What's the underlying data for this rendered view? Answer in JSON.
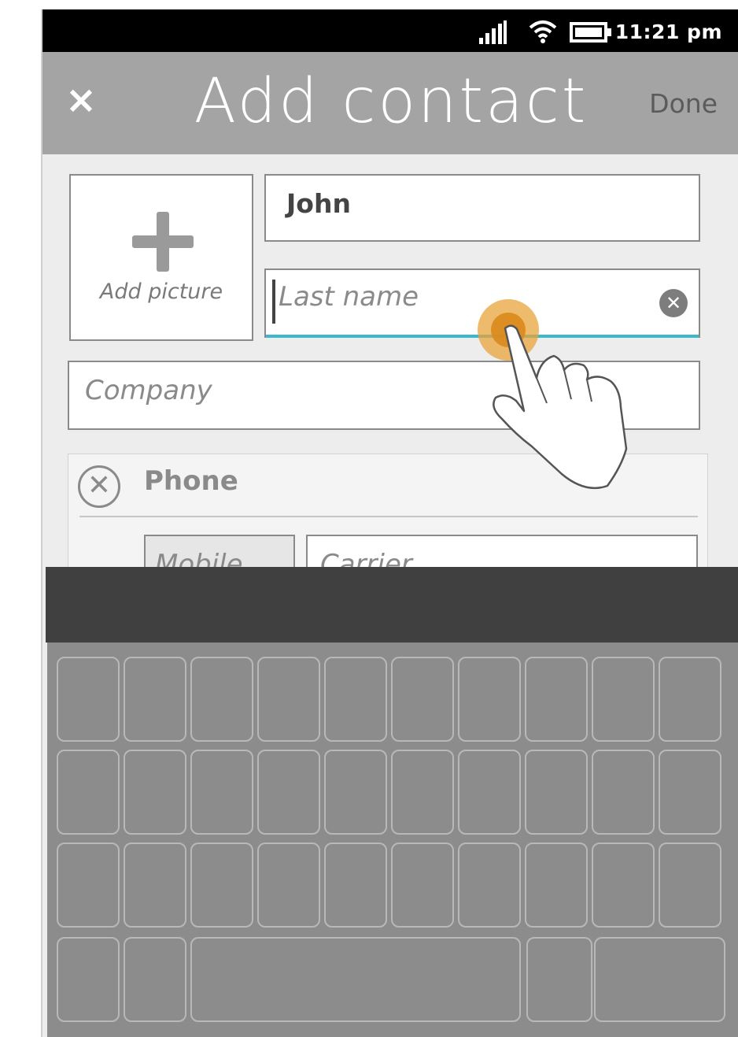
{
  "status_bar": {
    "time": "11:21 pm",
    "icons": [
      "signal-icon",
      "wifi-icon",
      "battery-icon"
    ]
  },
  "header": {
    "close_label": "×",
    "title": "Add contact",
    "done_label": "Done"
  },
  "form": {
    "add_picture_label": "Add picture",
    "first_name_value": "John",
    "last_name_placeholder": "Last name",
    "company_placeholder": "Company"
  },
  "phone_section": {
    "title": "Phone",
    "type_value": "Mobile",
    "carrier_placeholder": "Carrier"
  },
  "colors": {
    "header_bg": "#a3a4a3",
    "focus_accent": "#3bb8cb",
    "touch_indicator": "#e8a33a",
    "keyboard_bg": "#8c8c8c",
    "keyboard_bar": "#404040"
  }
}
